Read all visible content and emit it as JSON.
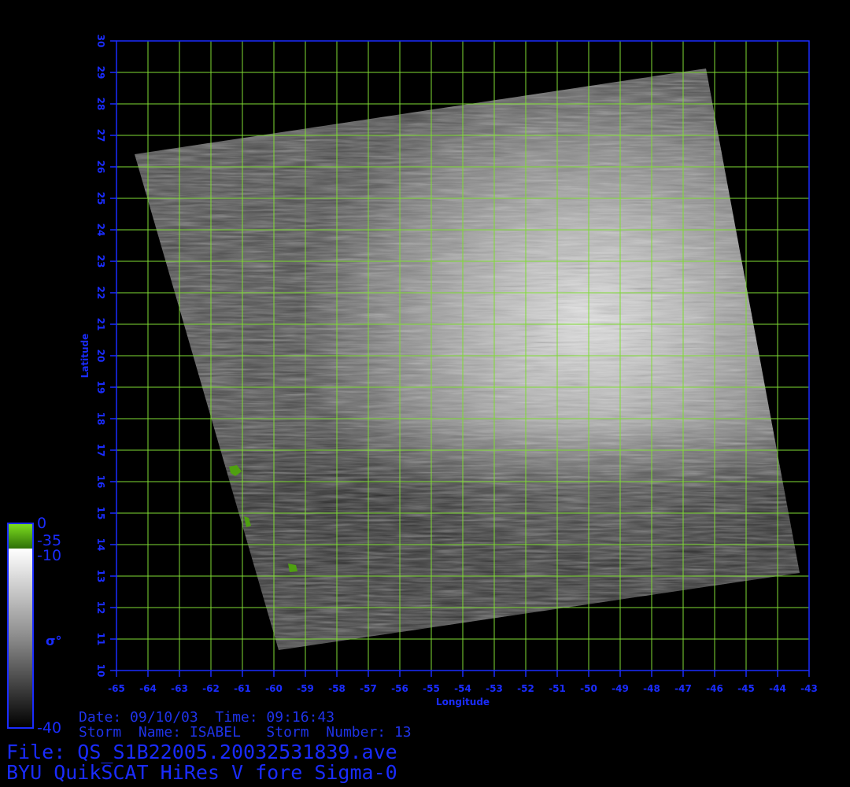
{
  "x_axis": {
    "label": "Longitude",
    "min": -65,
    "max": -43,
    "ticks": [
      "-65",
      "-64",
      "-63",
      "-62",
      "-61",
      "-60",
      "-59",
      "-58",
      "-57",
      "-56",
      "-55",
      "-54",
      "-53",
      "-52",
      "-51",
      "-50",
      "-49",
      "-48",
      "-47",
      "-46",
      "-45",
      "-44",
      "-43"
    ]
  },
  "y_axis": {
    "label": "Latitude",
    "min": 10,
    "max": 30,
    "ticks": [
      "10",
      "11",
      "12",
      "13",
      "14",
      "15",
      "16",
      "17",
      "18",
      "19",
      "20",
      "21",
      "22",
      "23",
      "24",
      "25",
      "26",
      "27",
      "28",
      "29",
      "30"
    ]
  },
  "colorbar": {
    "labels": [
      "0",
      "-35",
      "-10",
      "-40"
    ],
    "symbol": "σ°"
  },
  "info": {
    "date_line": "Date: 09/10/03  Time: 09:16:43",
    "storm_line": "Storm  Name: ISABEL   Storm  Number: 13",
    "file_line": "File: QS_S1B22005.20032531839.ave",
    "product_line": "BYU QuikSCAT HiRes V fore Sigma-0"
  },
  "colors": {
    "background": "#000000",
    "text": "#1a2cff",
    "grid": "#7fdc33",
    "axes_box": "#1a2cff",
    "land": "#4fa010"
  }
}
